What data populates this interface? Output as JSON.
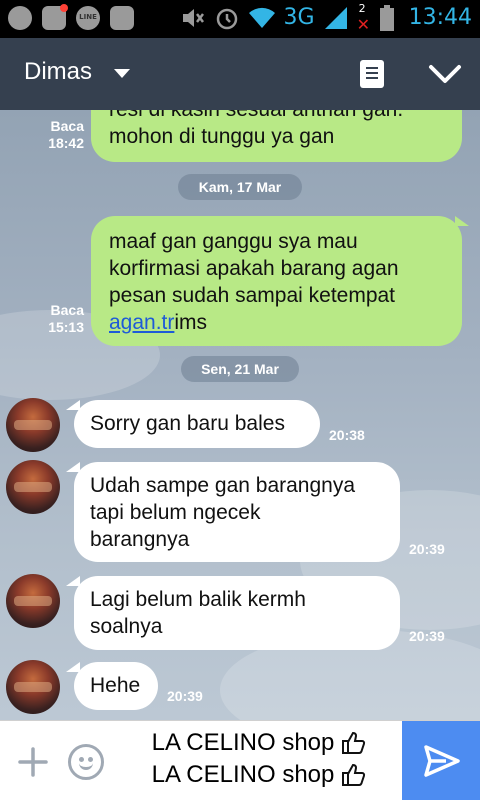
{
  "status_bar": {
    "network": "3G",
    "sim_badge": "2",
    "time": "13:44",
    "icons": [
      "whatsapp-icon",
      "bbm-icon",
      "line-icon",
      "bbm-icon",
      "mute-icon",
      "alarm-icon",
      "wifi-icon",
      "signal-icon",
      "battery-icon"
    ]
  },
  "header": {
    "contact_name": "Dimas",
    "icons": [
      "dropdown-caret-icon",
      "note-icon",
      "chevron-down-icon"
    ]
  },
  "messages": [
    {
      "sender": "me",
      "text_lines": [
        "resi di kasih sesuai antrian gan.",
        "mohon di tunggu ya gan"
      ],
      "status": "Baca",
      "time": "18:42"
    },
    {
      "type": "date",
      "label": "Kam, 17 Mar"
    },
    {
      "sender": "me",
      "text_lines": [
        "maaf gan ganggu sya mau",
        "korfirmasi apakah barang agan",
        "pesan sudah sampai ketempat"
      ],
      "link_text": "agan.tr",
      "link_suffix": "ims",
      "status": "Baca",
      "time": "15:13"
    },
    {
      "type": "date",
      "label": "Sen, 21 Mar"
    },
    {
      "sender": "them",
      "text_lines": [
        "Sorry gan baru bales"
      ],
      "time": "20:38"
    },
    {
      "sender": "them",
      "text_lines": [
        "Udah sampe gan barangnya",
        "tapi belum ngecek",
        "barangnya"
      ],
      "time": "20:39"
    },
    {
      "sender": "them",
      "text_lines": [
        "Lagi belum balik kermh",
        "soalnya"
      ],
      "time": "20:39"
    },
    {
      "sender": "them",
      "text_lines": [
        "Hehe"
      ],
      "time": "20:39"
    }
  ],
  "composer": {
    "lines": [
      "LA CELINO shop",
      "LA CELINO shop"
    ],
    "icons": [
      "plus-icon",
      "emoji-icon",
      "thumbs-up-icon",
      "send-icon"
    ]
  }
}
